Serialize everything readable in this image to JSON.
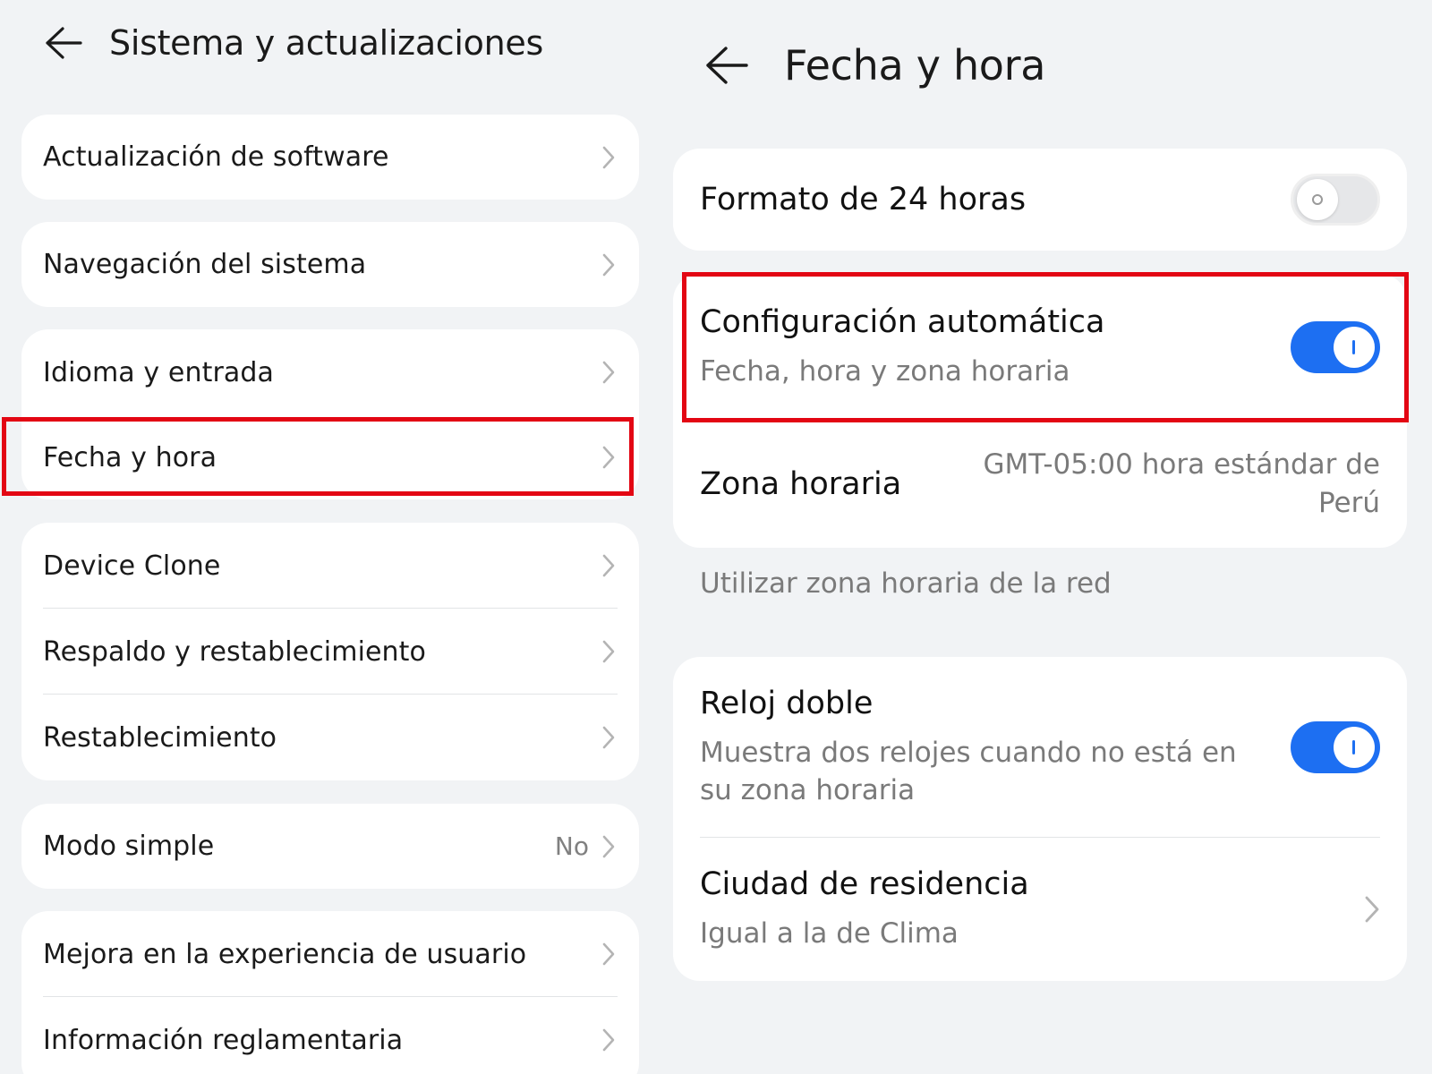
{
  "left": {
    "header": {
      "title": "Sistema y actualizaciones",
      "back_icon": "arrow-left-icon"
    },
    "groups": [
      {
        "items": [
          {
            "label": "Actualización de software"
          }
        ]
      },
      {
        "items": [
          {
            "label": "Navegación del sistema"
          }
        ]
      },
      {
        "items": [
          {
            "label": "Idioma y entrada"
          },
          {
            "label": "Fecha y hora"
          }
        ]
      },
      {
        "items": [
          {
            "label": "Device Clone"
          },
          {
            "label": "Respaldo y restablecimiento"
          },
          {
            "label": "Restablecimiento"
          }
        ]
      },
      {
        "items": [
          {
            "label": "Modo simple",
            "value": "No"
          }
        ]
      },
      {
        "items": [
          {
            "label": "Mejora en la experiencia de usuario"
          },
          {
            "label": "Información reglamentaria"
          }
        ]
      }
    ],
    "highlighted_item": "Fecha y hora"
  },
  "right": {
    "header": {
      "title": "Fecha y hora",
      "back_icon": "arrow-left-icon"
    },
    "format_24h": {
      "label": "Formato de 24 horas",
      "enabled": false
    },
    "auto_config": {
      "label": "Configuración automática",
      "sublabel": "Fecha, hora y zona horaria",
      "enabled": true
    },
    "time_zone": {
      "label": "Zona horaria",
      "value_line1": "GMT-05:00 hora estándar de",
      "value_line2": "Perú"
    },
    "network_caption": "Utilizar zona horaria de la red",
    "dual_clock": {
      "label": "Reloj doble",
      "sublabel_line1": "Muestra dos relojes cuando no está en",
      "sublabel_line2": "su zona horaria",
      "enabled": true
    },
    "home_city": {
      "label": "Ciudad de residencia",
      "sublabel": "Igual a la de Clima"
    }
  },
  "colors": {
    "highlight": "#e30613",
    "toggle_on": "#1d6ff2",
    "background": "#f1f3f5",
    "card": "#ffffff"
  }
}
